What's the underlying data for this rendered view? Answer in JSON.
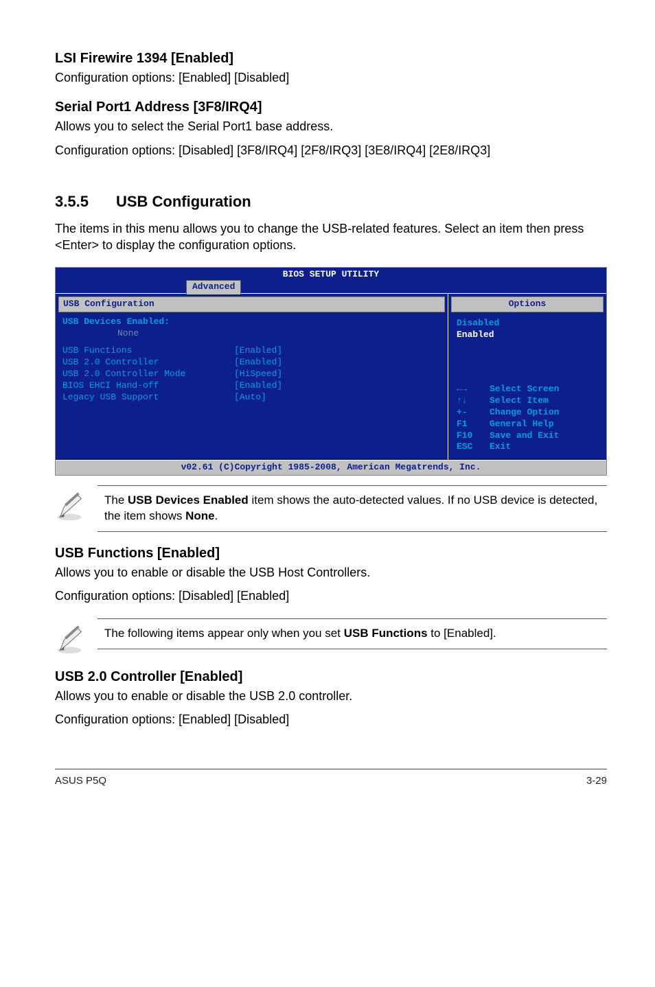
{
  "s1": {
    "head": "LSI Firewire 1394 [Enabled]",
    "body": "Configuration options: [Enabled] [Disabled]"
  },
  "s2": {
    "head": "Serial Port1 Address [3F8/IRQ4]",
    "body1": "Allows you to select the Serial Port1 base address.",
    "body2": "Configuration options: [Disabled] [3F8/IRQ4] [2F8/IRQ3] [3E8/IRQ4] [2E8/IRQ3]"
  },
  "s3": {
    "num": "3.5.5",
    "head": "USB Configuration",
    "body": "The items in this menu allows you to change the USB-related features. Select an item then press <Enter> to display the configuration options."
  },
  "bios": {
    "title": "BIOS SETUP UTILITY",
    "tab": "Advanced",
    "left_head": "USB Configuration",
    "devices_label": "USB Devices Enabled:",
    "devices_value": "None",
    "rows": [
      {
        "k": "USB Functions",
        "v": "[Enabled]"
      },
      {
        "k": "USB 2.0 Controller",
        "v": "[Enabled]"
      },
      {
        "k": "USB 2.0 Controller Mode",
        "v": "[HiSpeed]"
      },
      {
        "k": "BIOS EHCI Hand-off",
        "v": "[Enabled]"
      },
      {
        "k": "Legacy USB Support",
        "v": "[Auto]"
      }
    ],
    "right_head": "Options",
    "opt_disabled": "Disabled",
    "opt_enabled": "Enabled",
    "help": [
      {
        "k": "←→",
        "v": "Select Screen"
      },
      {
        "k": "↑↓",
        "v": "Select Item"
      },
      {
        "k": "+-",
        "v": "Change Option"
      },
      {
        "k": "F1",
        "v": "General Help"
      },
      {
        "k": "F10",
        "v": "Save and Exit"
      },
      {
        "k": "ESC",
        "v": "Exit"
      }
    ],
    "footer": "v02.61 (C)Copyright 1985-2008, American Megatrends, Inc."
  },
  "note1": {
    "t1": "The ",
    "b1": "USB Devices Enabled",
    "t2": " item shows the auto-detected values. If no USB device is detected, the item shows ",
    "b2": "None",
    "t3": "."
  },
  "s4": {
    "head": "USB Functions [Enabled]",
    "body1": "Allows you to enable or disable the USB Host Controllers.",
    "body2": "Configuration options: [Disabled] [Enabled]"
  },
  "note2": {
    "t1": "The following items appear only when you set ",
    "b1": "USB Functions",
    "t2": " to [Enabled]."
  },
  "s5": {
    "head": "USB 2.0 Controller [Enabled]",
    "body1": "Allows you to enable or disable the USB 2.0 controller.",
    "body2": "Configuration options: [Enabled] [Disabled]"
  },
  "footer": {
    "left": "ASUS P5Q",
    "right": "3-29"
  }
}
